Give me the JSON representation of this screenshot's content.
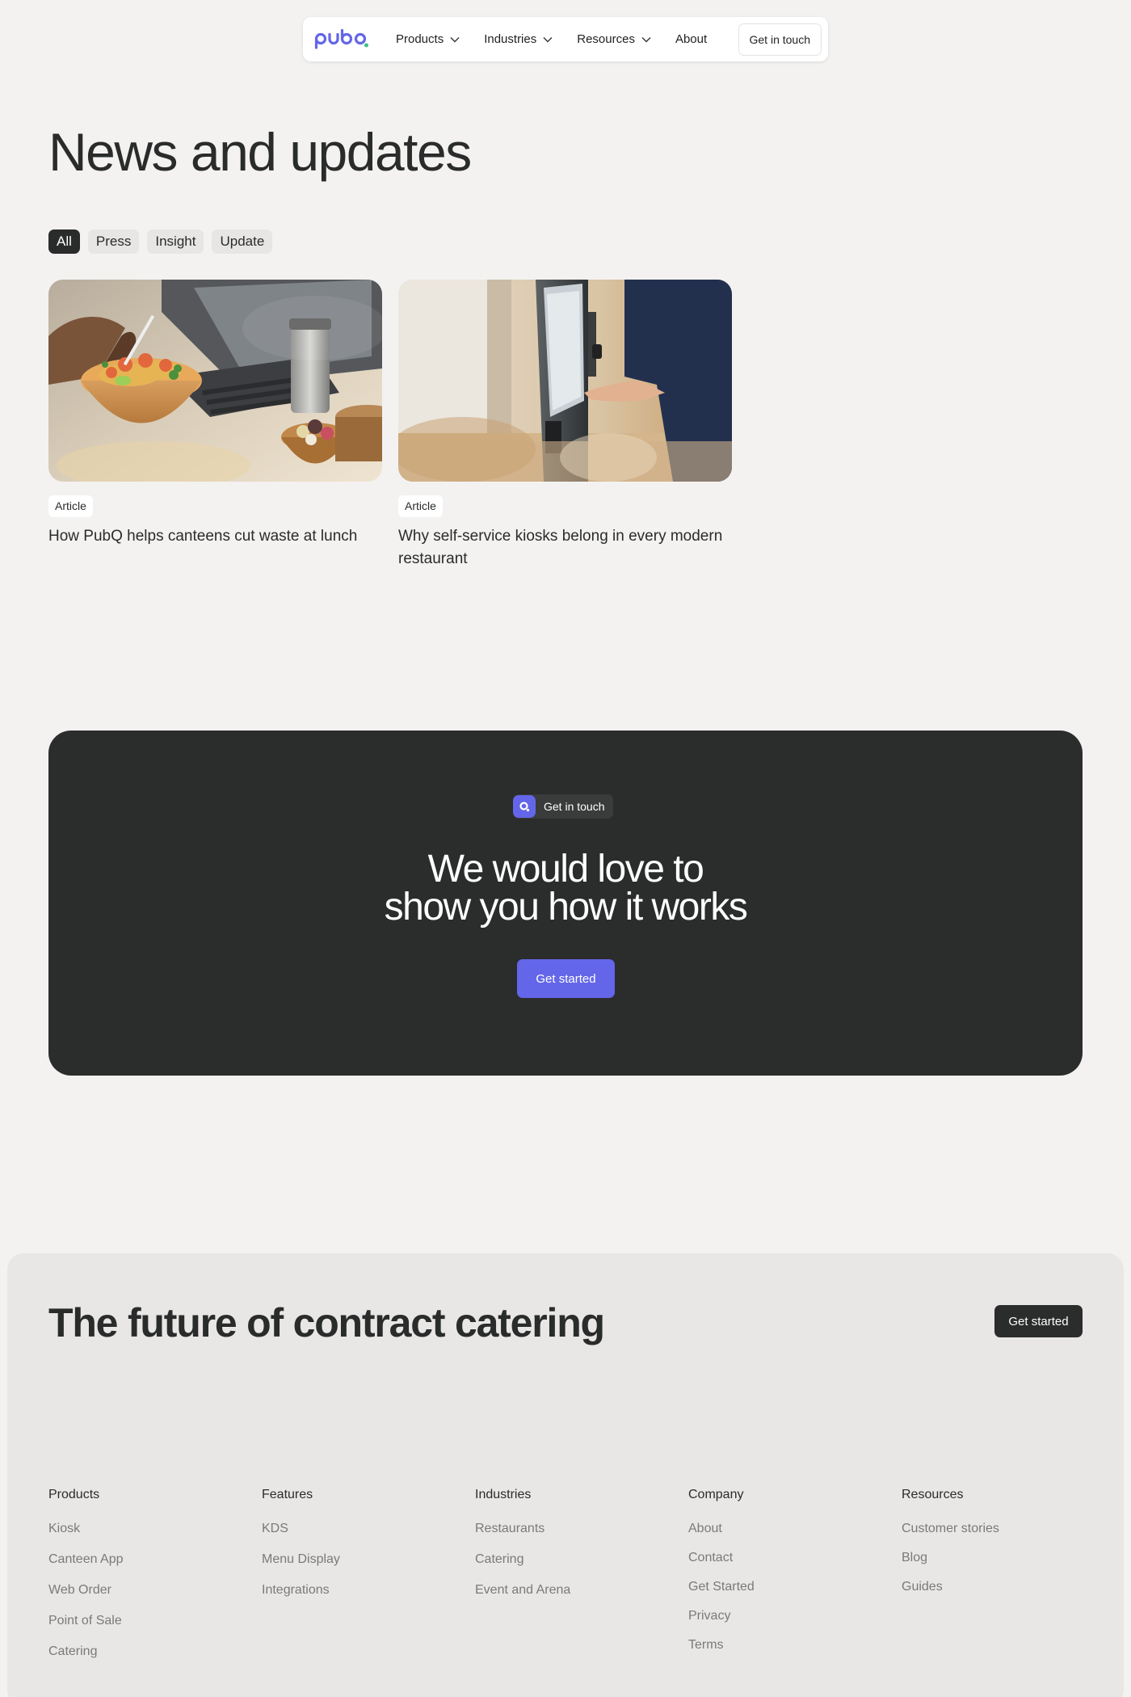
{
  "nav": {
    "brand": "pubq",
    "items": [
      {
        "label": "Products"
      },
      {
        "label": "Industries"
      },
      {
        "label": "Resources"
      }
    ],
    "about_label": "About",
    "cta_label": "Get in touch"
  },
  "hero": {
    "title": "News and updates",
    "filters": [
      "All",
      "Press",
      "Insight",
      "Update"
    ],
    "active_filter": "All"
  },
  "articles": [
    {
      "tag": "Article",
      "title": "How PubQ helps canteens cut waste at lunch",
      "image": "food-bowl-photo"
    },
    {
      "tag": "Article",
      "title": "Why self-service kiosks belong in every modern restaurant",
      "image": "kiosk-photo"
    }
  ],
  "cta": {
    "badge": "Get in touch",
    "title_line1": "We would love to",
    "title_line2": "show you how it works",
    "button": "Get started"
  },
  "footer": {
    "title": "The future of contract catering",
    "cta": "Get started",
    "columns": [
      {
        "heading": "Products",
        "links": [
          "Kiosk",
          "Canteen App",
          "Web Order",
          "Point of Sale",
          "Catering"
        ]
      },
      {
        "heading": "Features",
        "links": [
          "KDS",
          "Menu Display",
          "Integrations"
        ]
      },
      {
        "heading": "Industries",
        "links": [
          "Restaurants",
          "Catering",
          "Event and Arena"
        ]
      },
      {
        "heading": "Company",
        "links": [
          "About",
          "Contact",
          "Get Started",
          "Privacy",
          "Terms"
        ]
      },
      {
        "heading": "Resources",
        "links": [
          "Customer stories",
          "Blog",
          "Guides"
        ]
      }
    ]
  },
  "colors": {
    "accent": "#6366e8",
    "dark": "#2b2c2c",
    "background": "#f3f2f1",
    "footer_bg": "#e8e7e6"
  }
}
